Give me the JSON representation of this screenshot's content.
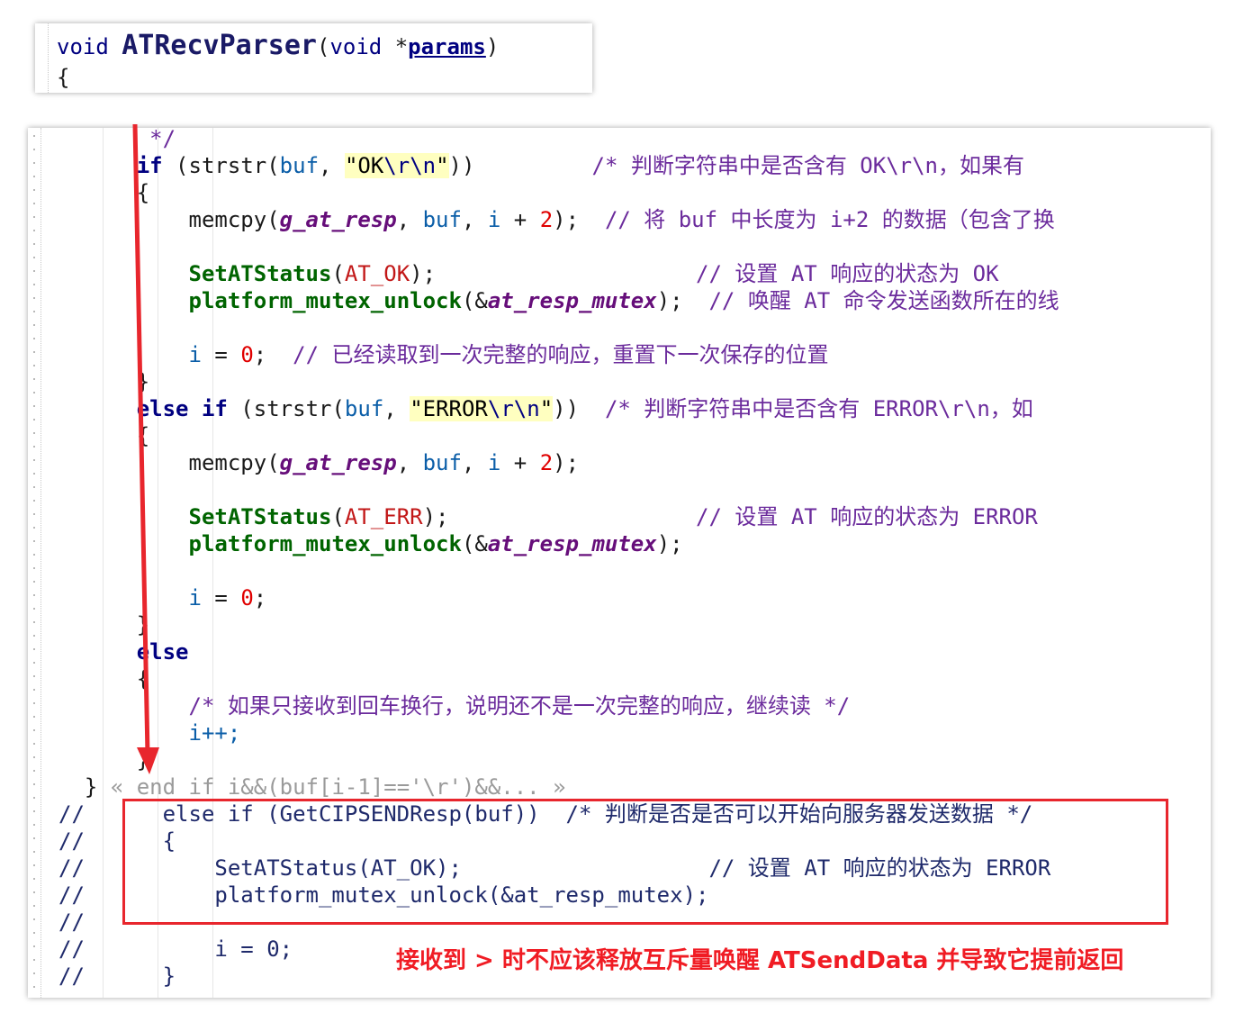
{
  "top_snippet": {
    "ret_type": "void",
    "func_name": "ATRecvParser",
    "open_paren": "(",
    "param_type": "void",
    "star": " *",
    "param_name": "params",
    "close_paren": ")",
    "brace": "{"
  },
  "code_lines": [
    {
      "indent": "       ",
      "tokens": [
        {
          "t": "*/",
          "c": "cm"
        }
      ]
    },
    {
      "indent": "      ",
      "tokens": [
        {
          "t": "if",
          "c": "kw"
        },
        {
          "t": " (",
          "c": ""
        },
        {
          "t": "strstr",
          "c": "fnplain"
        },
        {
          "t": "(",
          "c": ""
        },
        {
          "t": "buf",
          "c": "id"
        },
        {
          "t": ", ",
          "c": ""
        },
        {
          "t": "\"OK",
          "c": "strq"
        },
        {
          "t": "\\r\\n",
          "c": "esc"
        },
        {
          "t": "\"",
          "c": "strq"
        },
        {
          "t": "))         ",
          "c": ""
        },
        {
          "t": "/* 判断字符串中是否含有 OK\\r\\n，如果有",
          "c": "cm"
        }
      ]
    },
    {
      "indent": "      ",
      "tokens": [
        {
          "t": "{",
          "c": ""
        }
      ]
    },
    {
      "indent": "          ",
      "tokens": [
        {
          "t": "memcpy",
          "c": "fnplain"
        },
        {
          "t": "(",
          "c": ""
        },
        {
          "t": "g_at_resp",
          "c": "var"
        },
        {
          "t": ", ",
          "c": ""
        },
        {
          "t": "buf",
          "c": "id"
        },
        {
          "t": ", ",
          "c": ""
        },
        {
          "t": "i",
          "c": "id"
        },
        {
          "t": " + ",
          "c": ""
        },
        {
          "t": "2",
          "c": "num"
        },
        {
          "t": ");  ",
          "c": ""
        },
        {
          "t": "// 将 buf 中长度为 i+2 的数据（包含了换",
          "c": "cm"
        }
      ]
    },
    {
      "indent": "",
      "tokens": []
    },
    {
      "indent": "          ",
      "tokens": [
        {
          "t": "SetATStatus",
          "c": "fn"
        },
        {
          "t": "(",
          "c": ""
        },
        {
          "t": "AT_OK",
          "c": "mac"
        },
        {
          "t": ");                    ",
          "c": ""
        },
        {
          "t": "// 设置 AT 响应的状态为 OK",
          "c": "cm"
        }
      ]
    },
    {
      "indent": "          ",
      "tokens": [
        {
          "t": "platform_mutex_unlock",
          "c": "fn"
        },
        {
          "t": "(&",
          "c": ""
        },
        {
          "t": "at_resp_mutex",
          "c": "var"
        },
        {
          "t": ");  ",
          "c": ""
        },
        {
          "t": "// 唤醒 AT 命令发送函数所在的线",
          "c": "cm"
        }
      ]
    },
    {
      "indent": "",
      "tokens": []
    },
    {
      "indent": "          ",
      "tokens": [
        {
          "t": "i",
          "c": "id"
        },
        {
          "t": " = ",
          "c": ""
        },
        {
          "t": "0",
          "c": "num"
        },
        {
          "t": ";  ",
          "c": ""
        },
        {
          "t": "// 已经读取到一次完整的响应，重置下一次保存的位置",
          "c": "cm"
        }
      ]
    },
    {
      "indent": "      ",
      "tokens": [
        {
          "t": "}",
          "c": ""
        }
      ]
    },
    {
      "indent": "      ",
      "tokens": [
        {
          "t": "else if",
          "c": "kw"
        },
        {
          "t": " (",
          "c": ""
        },
        {
          "t": "strstr",
          "c": "fnplain"
        },
        {
          "t": "(",
          "c": ""
        },
        {
          "t": "buf",
          "c": "id"
        },
        {
          "t": ", ",
          "c": ""
        },
        {
          "t": "\"ERROR",
          "c": "strq"
        },
        {
          "t": "\\r\\n",
          "c": "esc"
        },
        {
          "t": "\"",
          "c": "strq"
        },
        {
          "t": "))  ",
          "c": ""
        },
        {
          "t": "/* 判断字符串中是否含有 ERROR\\r\\n，如",
          "c": "cm"
        }
      ]
    },
    {
      "indent": "      ",
      "tokens": [
        {
          "t": "{",
          "c": ""
        }
      ]
    },
    {
      "indent": "          ",
      "tokens": [
        {
          "t": "memcpy",
          "c": "fnplain"
        },
        {
          "t": "(",
          "c": ""
        },
        {
          "t": "g_at_resp",
          "c": "var"
        },
        {
          "t": ", ",
          "c": ""
        },
        {
          "t": "buf",
          "c": "id"
        },
        {
          "t": ", ",
          "c": ""
        },
        {
          "t": "i",
          "c": "id"
        },
        {
          "t": " + ",
          "c": ""
        },
        {
          "t": "2",
          "c": "num"
        },
        {
          "t": ");",
          "c": ""
        }
      ]
    },
    {
      "indent": "",
      "tokens": []
    },
    {
      "indent": "          ",
      "tokens": [
        {
          "t": "SetATStatus",
          "c": "fn"
        },
        {
          "t": "(",
          "c": ""
        },
        {
          "t": "AT_ERR",
          "c": "mac"
        },
        {
          "t": ");                   ",
          "c": ""
        },
        {
          "t": "// 设置 AT 响应的状态为 ERROR",
          "c": "cm"
        }
      ]
    },
    {
      "indent": "          ",
      "tokens": [
        {
          "t": "platform_mutex_unlock",
          "c": "fn"
        },
        {
          "t": "(&",
          "c": ""
        },
        {
          "t": "at_resp_mutex",
          "c": "var"
        },
        {
          "t": ");",
          "c": ""
        }
      ]
    },
    {
      "indent": "",
      "tokens": []
    },
    {
      "indent": "          ",
      "tokens": [
        {
          "t": "i",
          "c": "id"
        },
        {
          "t": " = ",
          "c": ""
        },
        {
          "t": "0",
          "c": "num"
        },
        {
          "t": ";",
          "c": ""
        }
      ]
    },
    {
      "indent": "      ",
      "tokens": [
        {
          "t": "}",
          "c": ""
        }
      ]
    },
    {
      "indent": "      ",
      "tokens": [
        {
          "t": "else",
          "c": "kw"
        }
      ]
    },
    {
      "indent": "      ",
      "tokens": [
        {
          "t": "{",
          "c": ""
        }
      ]
    },
    {
      "indent": "          ",
      "tokens": [
        {
          "t": "/* 如果只接收到回车换行，说明还不是一次完整的响应，继续读 */",
          "c": "cm"
        }
      ]
    },
    {
      "indent": "          ",
      "tokens": [
        {
          "t": "i++;",
          "c": "id"
        }
      ]
    },
    {
      "indent": "      ",
      "tokens": [
        {
          "t": "}",
          "c": ""
        }
      ]
    },
    {
      "indent": "  ",
      "tokens": [
        {
          "t": "}",
          "c": ""
        },
        {
          "t": " « end if i&&(buf[i-1]=='\\r')&&... »",
          "c": "fold"
        }
      ]
    },
    {
      "indent": "",
      "tokens": [
        {
          "t": "//      else if (GetCIPSENDResp(buf))  /* 判断是否是否可以开始向服务器发送数据 */",
          "c": "commented"
        }
      ]
    },
    {
      "indent": "",
      "tokens": [
        {
          "t": "//      {",
          "c": "commented"
        }
      ]
    },
    {
      "indent": "",
      "tokens": [
        {
          "t": "//          SetATStatus(AT_OK);                   // 设置 AT 响应的状态为 ERROR",
          "c": "commented"
        }
      ]
    },
    {
      "indent": "",
      "tokens": [
        {
          "t": "//          platform_mutex_unlock(&at_resp_mutex);",
          "c": "commented"
        }
      ]
    },
    {
      "indent": "",
      "tokens": [
        {
          "t": "//",
          "c": "commented"
        }
      ]
    },
    {
      "indent": "",
      "tokens": [
        {
          "t": "//          i = 0;",
          "c": "commented"
        }
      ]
    },
    {
      "indent": "",
      "tokens": [
        {
          "t": "//      }",
          "c": "commented"
        }
      ]
    }
  ],
  "annotation_text": "接收到 > 时不应该释放互斥量唤醒 ATSendData 并导致它提前返回",
  "colors": {
    "annotation": "#f01c24",
    "box": "#e8262d",
    "arrow": "#e8262d"
  }
}
